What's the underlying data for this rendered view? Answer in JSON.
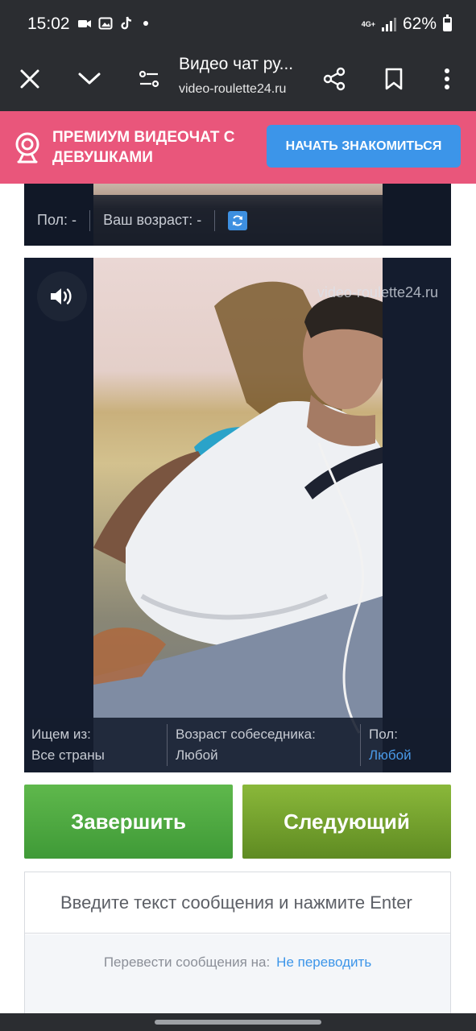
{
  "status_bar": {
    "time": "15:02",
    "network": "4G+",
    "battery": "62%",
    "battery_level": 0.62,
    "icons": [
      "video-call-icon",
      "gallery-icon",
      "tiktok-icon",
      "notification-dot"
    ]
  },
  "browser": {
    "title": "Видео чат ру...",
    "url": "video-roulette24.ru",
    "icons": [
      "close-icon",
      "chevron-down-icon",
      "page-settings-icon",
      "share-icon",
      "bookmark-icon",
      "more-icon"
    ]
  },
  "promo": {
    "text": "ПРЕМИУМ ВИДЕОЧАТ С ДЕВУШКАМИ",
    "button": "НАЧАТЬ ЗНАКОМИТЬСЯ",
    "bg_color": "#e9567b",
    "button_color": "#3c95e9"
  },
  "self_panel": {
    "gender_label": "Пол: -",
    "age_label": "Ваш возраст: -"
  },
  "partner_panel": {
    "watermark": "video-roulette24.ru",
    "search_from_label": "Ищем из:",
    "search_from_value": "Все страны",
    "partner_age_label": "Возраст собеседника:",
    "partner_age_value": "Любой",
    "gender_label": "Пол:",
    "gender_value": "Любой"
  },
  "actions": {
    "end": "Завершить",
    "next": "Следующий"
  },
  "message": {
    "placeholder": "Введите текст сообщения и нажмите Enter",
    "translate_label": "Перевести сообщения на:",
    "translate_value": "Не переводить"
  }
}
